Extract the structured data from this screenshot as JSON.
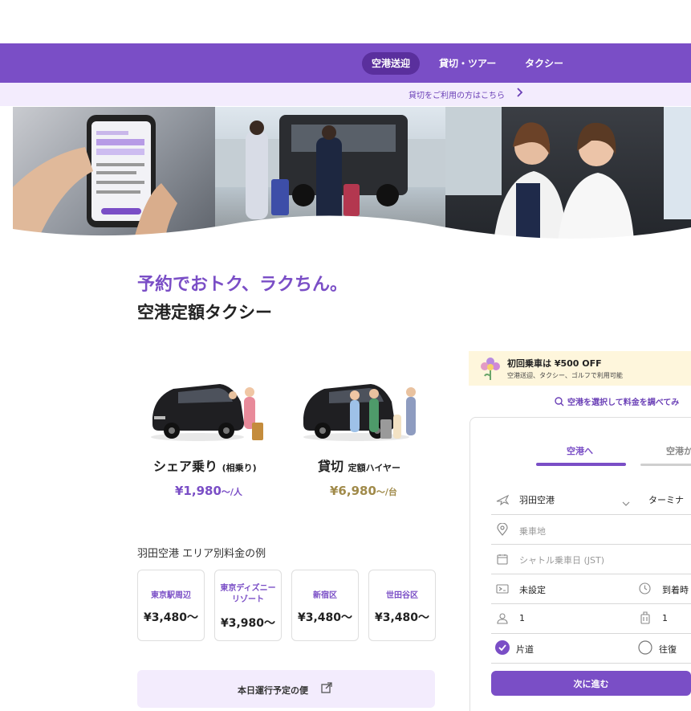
{
  "nav": {
    "tabs": [
      {
        "label": "空港送迎",
        "active": true
      },
      {
        "label": "貸切・ツアー",
        "active": false
      },
      {
        "label": "タクシー",
        "active": false
      }
    ]
  },
  "subbar": {
    "link_label": "貸切をご利用の方はこちら"
  },
  "headline": {
    "line1": "予約でおトク、ラクちん。",
    "line2": "空港定額タクシー"
  },
  "services": {
    "share": {
      "name": "シェア乗り",
      "note": "(相乗り)",
      "price": "¥1,980",
      "unit": "〜/人"
    },
    "charter": {
      "name": "貸切",
      "note": "定額ハイヤー",
      "price": "¥6,980",
      "unit": "〜/台"
    }
  },
  "areas": {
    "title": "羽田空港 エリア別料金の例",
    "items": [
      {
        "name": "東京駅周辺",
        "price": "¥3,480〜"
      },
      {
        "name": "東京ディズニーリゾート",
        "price": "¥3,980〜"
      },
      {
        "name": "新宿区",
        "price": "¥3,480〜"
      },
      {
        "name": "世田谷区",
        "price": "¥3,480〜"
      }
    ]
  },
  "today_button": {
    "label": "本日運行予定の便"
  },
  "promo": {
    "title": "初回乗車は ¥500 OFF",
    "subtitle": "空港送迎、タクシー、ゴルフで利用可能"
  },
  "check_link": {
    "label": "空港を選択して料金を調べてみ"
  },
  "form": {
    "tab_to": "空港へ",
    "tab_from": "空港か",
    "airport": "羽田空港",
    "terminal": "ターミナ",
    "pickup_placeholder": "乗車地",
    "date_placeholder": "シャトル乗車日 (JST)",
    "flight_value": "未設定",
    "arrival_label": "到着時",
    "passengers": "1",
    "luggage": "1",
    "one_way": "片道",
    "round_trip": "往復",
    "next_label": "次に進む"
  },
  "colors": {
    "brand": "#7a4ec6",
    "brand_dark": "#5a2f9d",
    "light": "#f3ecfd",
    "gold": "#a08a4a",
    "promo_bg": "#fef6dc"
  }
}
